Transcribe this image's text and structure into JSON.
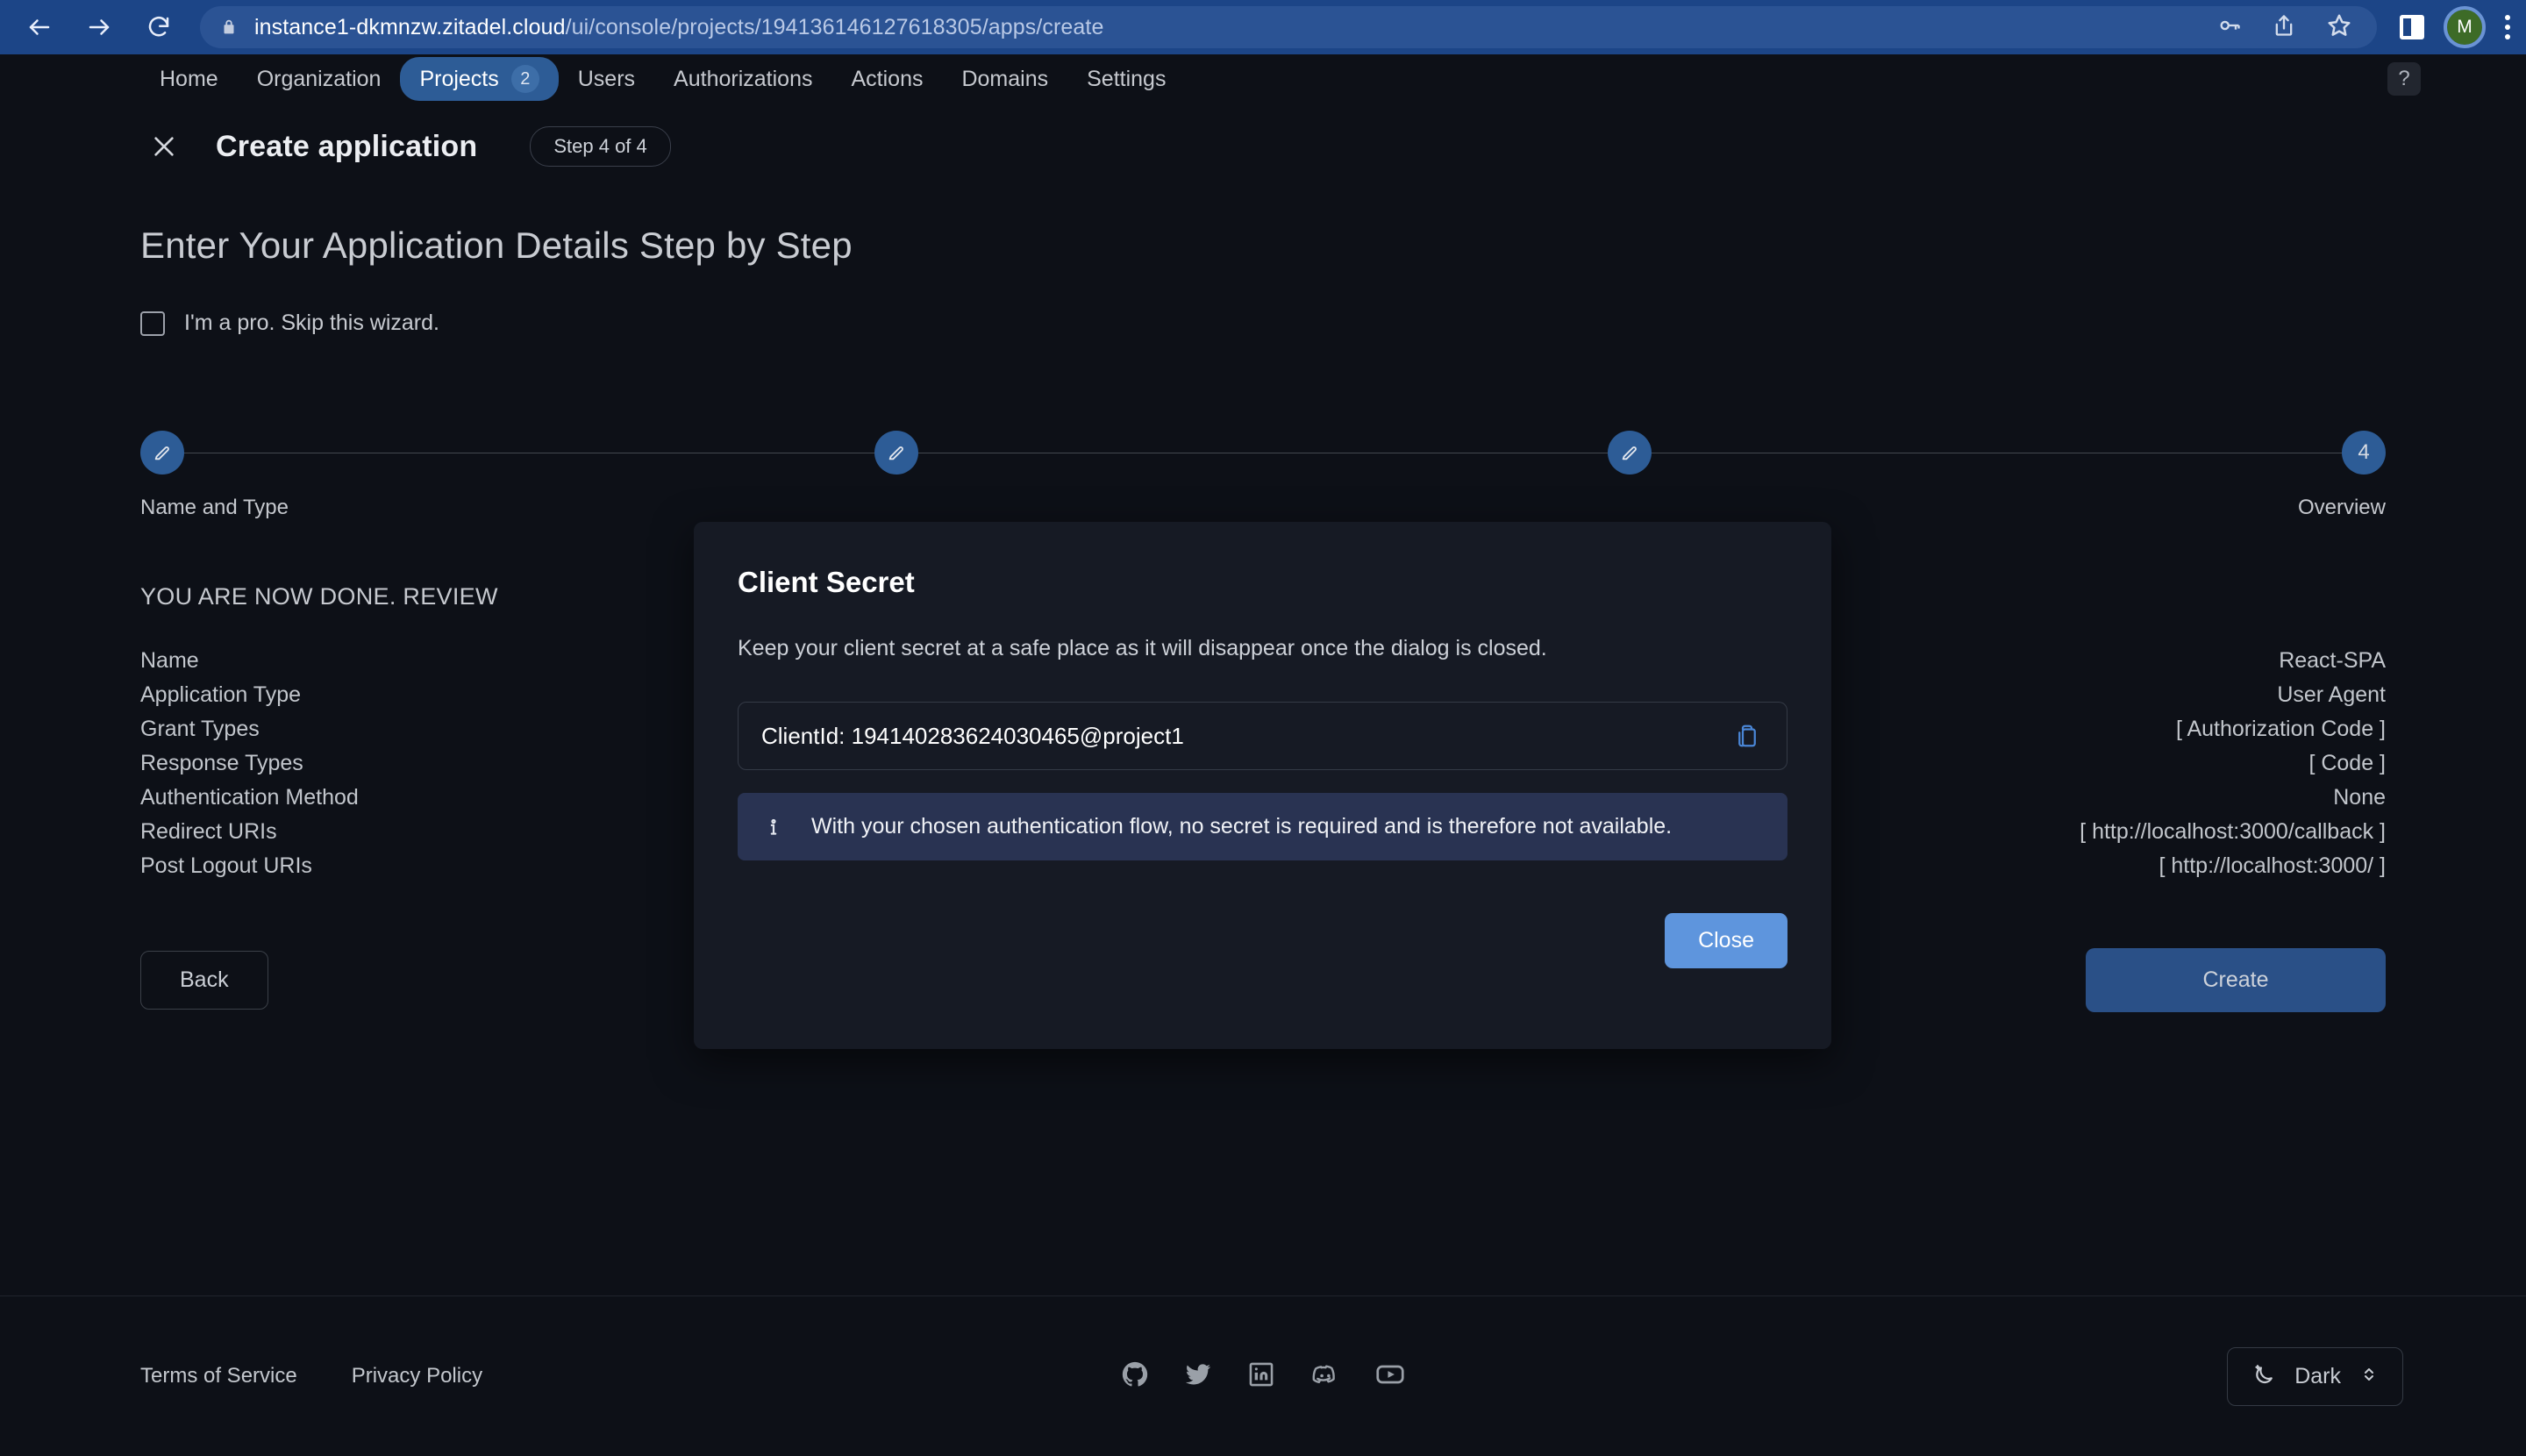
{
  "browser": {
    "url_host": "instance1-dkmnzw.zitadel.cloud",
    "url_path": "/ui/console/projects/194136146127618305/apps/create",
    "back_icon": "back-arrow-icon",
    "forward_icon": "forward-arrow-icon",
    "reload_icon": "reload-icon",
    "lock_icon": "lock-icon",
    "key_icon": "key-icon",
    "share_icon": "share-icon",
    "bookmark_icon": "star-icon",
    "sidepanel_icon": "side-panel-icon",
    "menu_icon": "three-dot-menu-icon",
    "avatar_letter": "M"
  },
  "app_nav": {
    "items": [
      {
        "label": "Home",
        "active": false
      },
      {
        "label": "Organization",
        "active": false
      },
      {
        "label": "Projects",
        "active": true,
        "badge": "2"
      },
      {
        "label": "Users",
        "active": false
      },
      {
        "label": "Authorizations",
        "active": false
      },
      {
        "label": "Actions",
        "active": false
      },
      {
        "label": "Domains",
        "active": false
      },
      {
        "label": "Settings",
        "active": false
      }
    ],
    "help_label": "?"
  },
  "wizard": {
    "close_icon": "close-icon",
    "title": "Create application",
    "step_chip": "Step 4 of 4",
    "headline": "Enter Your Application Details Step by Step",
    "pro_checkbox_label": "I'm a pro. Skip this wizard.",
    "pro_checked": false
  },
  "stepper": {
    "steps": [
      {
        "marker": "edit-icon",
        "label": "Name and Type"
      },
      {
        "marker": "edit-icon",
        "label": ""
      },
      {
        "marker": "edit-icon",
        "label": ""
      },
      {
        "marker": "4",
        "label": "Overview"
      }
    ]
  },
  "review": {
    "title": "YOU ARE NOW DONE. REVIEW",
    "rows": [
      {
        "key": "Name",
        "value": "React-SPA"
      },
      {
        "key": "Application Type",
        "value": "User Agent"
      },
      {
        "key": "Grant Types",
        "value": "[ Authorization Code ]"
      },
      {
        "key": "Response Types",
        "value": "[ Code ]"
      },
      {
        "key": "Authentication Method",
        "value": "None"
      },
      {
        "key": "Redirect URIs",
        "value": "[ http://localhost:3000/callback ]"
      },
      {
        "key": "Post Logout URIs",
        "value": "[ http://localhost:3000/ ]"
      }
    ]
  },
  "actions": {
    "back_label": "Back",
    "create_label": "Create"
  },
  "modal": {
    "title": "Client Secret",
    "description": "Keep your client secret at a safe place as it will disappear once the dialog is closed.",
    "client_id_text": "ClientId: 194140283624030465@project1",
    "copy_icon": "copy-clipboard-icon",
    "info_icon": "info-icon",
    "info_text": "With your chosen authentication flow, no secret is required and is therefore not available.",
    "close_label": "Close"
  },
  "footer": {
    "links": [
      {
        "label": "Terms of Service"
      },
      {
        "label": "Privacy Policy"
      }
    ],
    "socials": [
      {
        "name": "github-icon"
      },
      {
        "name": "twitter-icon"
      },
      {
        "name": "linkedin-icon"
      },
      {
        "name": "discord-icon"
      },
      {
        "name": "youtube-icon"
      }
    ],
    "theme_label": "Dark",
    "theme_icon": "moon-icon",
    "theme_chevrons_icon": "up-down-chevron-icon"
  },
  "colors": {
    "page_bg": "#0d1017",
    "browser_bar": "#1c4587",
    "accent_blue": "#2d5c96",
    "modal_bg": "#161a24",
    "close_button": "#5e95dd",
    "create_button": "#2a5087",
    "info_banner": "#293352",
    "copy_icon": "#4a86d6"
  }
}
